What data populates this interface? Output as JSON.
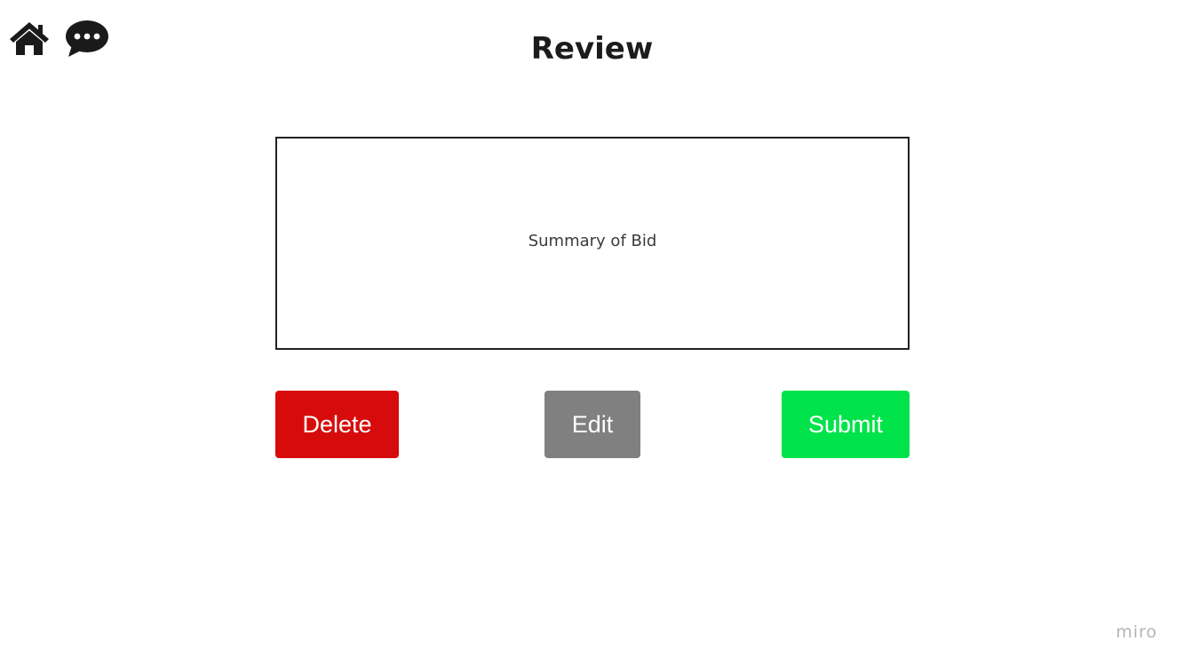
{
  "header": {
    "title": "Review",
    "home_icon": "home-icon",
    "chat_icon": "chat-bubble-icon"
  },
  "summary": {
    "text": "Summary of Bid"
  },
  "actions": {
    "delete_label": "Delete",
    "edit_label": "Edit",
    "submit_label": "Submit"
  },
  "colors": {
    "delete": "#d70b0b",
    "edit": "#808080",
    "submit": "#00e34a",
    "icon": "#1a1a1a"
  },
  "watermark": "miro"
}
